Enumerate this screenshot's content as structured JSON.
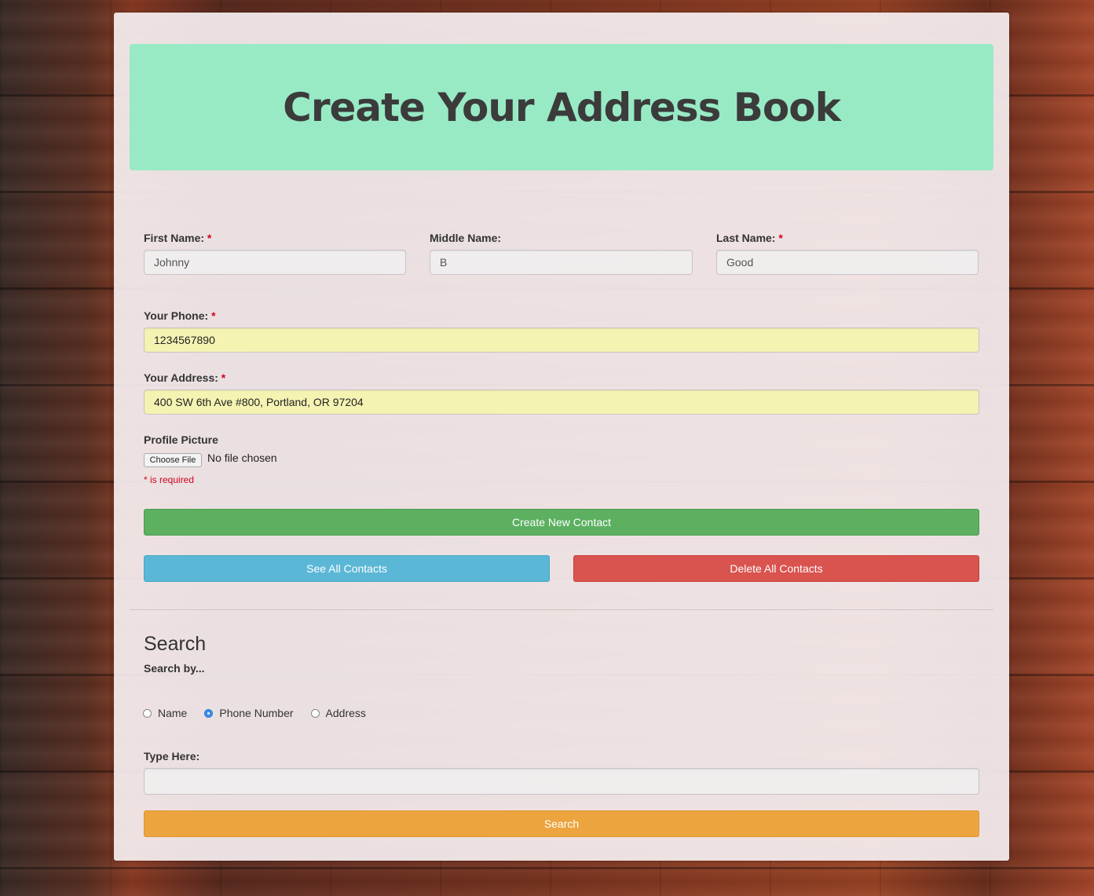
{
  "header": {
    "title": "Create Your Address Book"
  },
  "form": {
    "first_name": {
      "label": "First Name:",
      "value": "Johnny"
    },
    "middle_name": {
      "label": "Middle Name:",
      "value": "B"
    },
    "last_name": {
      "label": "Last Name:",
      "value": "Good"
    },
    "phone": {
      "label": "Your Phone:",
      "value": "1234567890"
    },
    "address": {
      "label": "Your Address:",
      "value": "400 SW 6th Ave #800, Portland, OR 97204"
    },
    "profile_picture": {
      "label": "Profile Picture",
      "button": "Choose File",
      "status": "No file chosen"
    },
    "required_marker": "*",
    "required_note": "* is required",
    "create_button": "Create New Contact",
    "see_all_button": "See All Contacts",
    "delete_all_button": "Delete All Contacts"
  },
  "search": {
    "title": "Search",
    "subtitle": "Search by...",
    "options": [
      {
        "label": "Name",
        "checked": false
      },
      {
        "label": "Phone Number",
        "checked": true
      },
      {
        "label": "Address",
        "checked": false
      }
    ],
    "input_label": "Type Here:",
    "input_value": "",
    "button": "Search"
  },
  "colors": {
    "banner": "#98eac5",
    "create": "#5cb060",
    "see_all": "#5bb7d6",
    "delete": "#d9534f",
    "search": "#eca43e",
    "required": "#d0021b"
  }
}
